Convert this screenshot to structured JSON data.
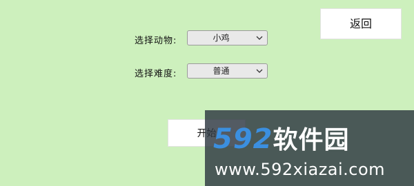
{
  "form": {
    "animal_label": "选择动物:",
    "animal_value": "小鸡",
    "difficulty_label": "选择难度:",
    "difficulty_value": "普通"
  },
  "buttons": {
    "back_label": "返回",
    "start_label": "开始"
  },
  "watermark": {
    "brand_number": "592",
    "brand_text": "软件园",
    "url": "www.592xiazai.com"
  },
  "colors": {
    "background": "#cdf0bd",
    "button": "#ffffff",
    "select": "#e9e9e9",
    "watermark_accent": "#3b8fe0"
  }
}
